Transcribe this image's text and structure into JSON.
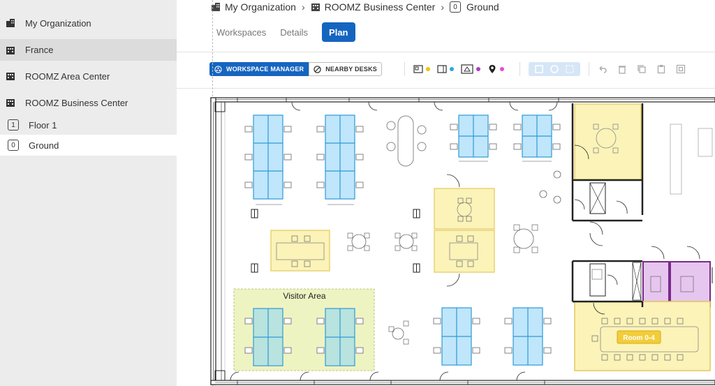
{
  "sidebar": {
    "items": [
      {
        "label": "My Organization",
        "icon": "building-icon"
      },
      {
        "label": "France",
        "icon": "building-icon"
      },
      {
        "label": "ROOMZ Area Center",
        "icon": "building-icon"
      },
      {
        "label": "ROOMZ Business Center",
        "icon": "building-icon"
      },
      {
        "label": "Floor 1",
        "badge": "1"
      },
      {
        "label": "Ground",
        "badge": "0"
      }
    ]
  },
  "breadcrumb": {
    "org": "My Organization",
    "building": "ROOMZ Business Center",
    "floor_badge": "0",
    "floor": "Ground"
  },
  "tabs": [
    {
      "label": "Workspaces"
    },
    {
      "label": "Details"
    },
    {
      "label": "Plan",
      "active": true
    }
  ],
  "toolbar": {
    "workspace_manager": "WORKSPACE MANAGER",
    "nearby_desks": "NEARBY DESKS",
    "dot_colors": [
      "#f2c200",
      "#29a8e0",
      "#b03cc8",
      "#e84bd6"
    ]
  },
  "plan": {
    "visitor_area_label": "Visitor Area",
    "room_label": "Room 0-4",
    "colors": {
      "desk_blue": "#bfe6fb",
      "desk_blue_stroke": "#2f9ad6",
      "zone_yellow": "#fbf3b8",
      "zone_yellow_stroke": "#e3c95a",
      "room_purple": "#e6c6ee",
      "room_purple_stroke": "#7a2a8a",
      "visitor_green": "#eef3c2",
      "teal_desk": "#b8e3de"
    }
  }
}
